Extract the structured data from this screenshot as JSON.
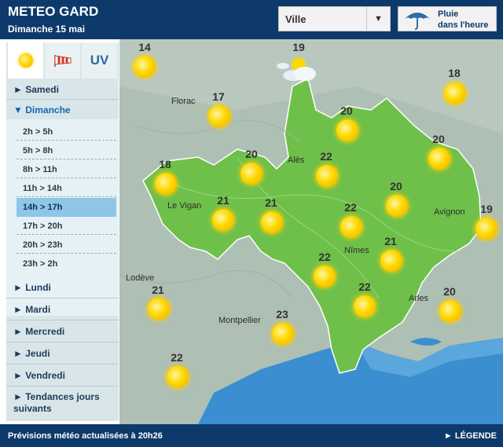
{
  "header": {
    "title": "METEO GARD",
    "date": "Dimanche 15 mai",
    "city_select": "Ville",
    "hourly_line1": "Pluie",
    "hourly_line2": "dans l'heure"
  },
  "tabs": {
    "uv": "UV"
  },
  "days": [
    "Samedi",
    "Dimanche",
    "Lundi",
    "Mardi",
    "Mercredi",
    "Jeudi",
    "Vendredi",
    "Tendances jours suivants"
  ],
  "slots": [
    "2h > 5h",
    "5h > 8h",
    "8h > 11h",
    "11h > 14h",
    "14h > 17h",
    "17h > 20h",
    "20h > 23h",
    "23h > 2h"
  ],
  "map": {
    "cities": {
      "florac": "Florac",
      "ales": "Alès",
      "le_vigan": "Le Vigan",
      "nimes": "Nîmes",
      "avignon": "Avignon",
      "lodeve": "Lodève",
      "montpellier": "Montpellier",
      "arles": "Arles"
    },
    "temps": [
      "14",
      "19",
      "18",
      "17",
      "20",
      "20",
      "18",
      "20",
      "22",
      "20",
      "21",
      "21",
      "22",
      "19",
      "21",
      "22",
      "21",
      "22",
      "20",
      "23",
      "22"
    ],
    "colors": {
      "gard": "#6fc04a",
      "outside": "#a9bdb0",
      "sea": "#3b8fd0",
      "sun": "#ffd800"
    }
  },
  "footer": {
    "update": "Prévisions météo actualisées à 20h26",
    "legend": "LÉGENDE"
  }
}
